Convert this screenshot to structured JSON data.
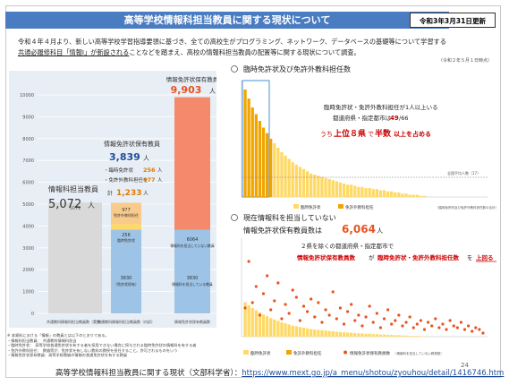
{
  "header": {
    "title": "高等学校情報科担当教員に関する現状について",
    "date_badge": "令和3年3月31日更新"
  },
  "intro": {
    "line1": "令和４年４月より、新しい高等学校学習指導要領に基づき、全ての高校生がプログラミング、ネットワーク、データベースの基礎等について学習する",
    "line2_underlined": "共通必履修科目「情報Ⅰ」が新設される",
    "line2_rest": "ことなどを踏まえ、高校の情報科担当教員の配置等に関する現状について調査。",
    "date_note": "（令和２年５月１日時点）"
  },
  "left_chart": {
    "y_ticks": [
      "0",
      "1000",
      "2000",
      "3000",
      "4000",
      "5000",
      "6000",
      "7000",
      "8000",
      "9000",
      "10000"
    ],
    "col1": {
      "title": "情報科担当教員",
      "value": "5,072",
      "unit": "人",
      "bar_label": "5072",
      "xlabel": "共通教科情報科担当教員数（実数）"
    },
    "col2": {
      "title": "情報免許状保有教員",
      "total": "3,839",
      "unit": "人",
      "rinji_label": "・臨時免許状",
      "rinji": "256",
      "rinji_unit": "人",
      "menkyo_label": "・免許外教科担任を",
      "menkyo": "977",
      "menkyo_unit": "人",
      "kei_label": "計",
      "kei": "1,233",
      "kei_unit": "人",
      "seg_orange": "977",
      "seg_orange_label": "免許外教科担任",
      "seg_yellow": "256",
      "seg_yellow_label": "臨時免許状",
      "seg_blue": "3830",
      "seg_blue_label": "（免許状保有）",
      "xlabel": "共通教科情報科担当教員数（内訳）"
    },
    "col3": {
      "title": "情報免許状保有教員",
      "value": "9,903",
      "unit": "人",
      "seg_red": "6064",
      "seg_red_label": "情報科を担当していない教員",
      "seg_blue": "3830",
      "seg_blue_label": "情報科を担当している教員",
      "xlabel": "情報免許状保有教員数"
    }
  },
  "panel1": {
    "title": "臨時免許状及び免許外教科担任数",
    "note1": "臨時免許状・免許外教科担任が1人以上いる",
    "note2_a": "都道府県・指定都市は",
    "note2_b": "49",
    "note2_c": "/66",
    "note3_a": "うち",
    "note3_b": "上位８県",
    "note3_c": "で",
    "note3_d": "半数",
    "note3_e": "以上を占める",
    "median_label": "全国平均人数（17）",
    "legend1": "臨時免許状",
    "legend2": "免許外教科担任",
    "legend_note": "（臨時免許状及び免許外教科担任数の合計）"
  },
  "panel2": {
    "title1": "現在情報科を担当していない",
    "title2": "情報免許状保有教員数は",
    "value": "6,064",
    "unit": "人",
    "note1": "２県を除くの都道府県・指定都市で",
    "note2_a": "情報免許状保有教員数",
    "note2_b": "が",
    "note2_c": "臨時免許状・免許外教科担任数",
    "note2_d": "を",
    "note2_e": "上回る",
    "legend1": "臨時免許状",
    "legend2": "免許外教科担任",
    "legend3": "情報免許状保有教員数",
    "legend_note": "（情報科を担当していない教員数）"
  },
  "footnotes": [
    "※ 本資料における「情報」の教員とは以下のとおりである。",
    "・情報科担当教員：　共通教科情報科担当",
    "・臨時免許状：　高等学校普通免許状を有する者を採用できない場合に授与される臨時免許状の情報科を有する者",
    "・免許外教科担任：　教諭等が、免許状を有しない教科の教授を担任すること。許可されるものをいう",
    "・情報免許状保有教員：高等学校教諭の情報の普通免許状を有する教員"
  ],
  "source": {
    "label": "高等学校情報科担当教員に関する現状（文部科学省）：",
    "url": "https://www.mext.go.jp/a_menu/shotou/zyouhou/detail/1416746.htm"
  },
  "page_number": "24",
  "chart_data": [
    {
      "type": "bar",
      "title": "",
      "categories": [
        "共通教科情報科担当教員数（実数）",
        "共通教科情報科担当教員数（内訳）",
        "情報免許状保有教員数"
      ],
      "series": [
        {
          "name": "",
          "values": [
            5072,
            0,
            0
          ]
        },
        {
          "name": "（免許状保有）",
          "values": [
            0,
            3830,
            3830
          ]
        },
        {
          "name": "臨時免許状",
          "values": [
            0,
            256,
            0
          ]
        },
        {
          "name": "免許外教科担任",
          "values": [
            0,
            977,
            0
          ]
        },
        {
          "name": "情報科を担当していない教員",
          "values": [
            0,
            0,
            6064
          ]
        }
      ],
      "ylim": [
        0,
        10000
      ],
      "colors": {
        "gray": "#d9d9d9",
        "blue": "#9dc3e6",
        "yellow": "#ffd966",
        "orange": "#f4b183",
        "red": "#f2795a"
      }
    },
    {
      "type": "bar",
      "title": "臨時免許状及び免許外教科担任数",
      "values": [
        96,
        88,
        80,
        74,
        68,
        62,
        57,
        52,
        48,
        44,
        40,
        37,
        34,
        31,
        29,
        27,
        25,
        23,
        21,
        20,
        19,
        18,
        17,
        16,
        15,
        14,
        13,
        12,
        11,
        11,
        10,
        9,
        9,
        8,
        8,
        7,
        7,
        6,
        6,
        5,
        5,
        4,
        4,
        3,
        3,
        2,
        2,
        2,
        1,
        1,
        0,
        0,
        0,
        0,
        0,
        0,
        0,
        0,
        0,
        0,
        0,
        0,
        0,
        0,
        0,
        0
      ],
      "ylim": [
        0,
        100
      ],
      "highlight_first": 8,
      "median": 17
    },
    {
      "type": "scatter",
      "title": "現在情報科を担当していない情報免許状保有教員数",
      "bars": [
        96,
        88,
        80,
        74,
        68,
        62,
        57,
        52,
        48,
        44,
        40,
        37,
        34,
        31,
        29,
        27,
        25,
        23,
        21,
        20,
        19,
        18,
        17,
        16,
        15,
        14,
        13,
        12,
        11,
        11,
        10,
        9,
        9,
        8,
        8,
        7,
        7,
        6,
        6,
        5,
        5,
        4,
        4,
        3,
        3,
        2,
        2,
        2,
        1,
        1,
        0,
        0,
        0,
        0,
        0,
        0,
        0,
        0,
        0,
        0,
        0,
        0,
        0,
        0,
        0,
        0
      ],
      "points": [
        80,
        210,
        95,
        140,
        60,
        120,
        170,
        75,
        100,
        150,
        50,
        90,
        65,
        130,
        110,
        45,
        85,
        70,
        105,
        55,
        95,
        40,
        75,
        60,
        125,
        50,
        80,
        35,
        70,
        90,
        45,
        60,
        30,
        55,
        85,
        40,
        65,
        25,
        50,
        75,
        35,
        45,
        60,
        30,
        40,
        55,
        25,
        35,
        45,
        20,
        40,
        30,
        50,
        25,
        35,
        20,
        45,
        30,
        25,
        40,
        20,
        30,
        15,
        25,
        20,
        10
      ],
      "ylim": [
        0,
        250
      ]
    }
  ]
}
